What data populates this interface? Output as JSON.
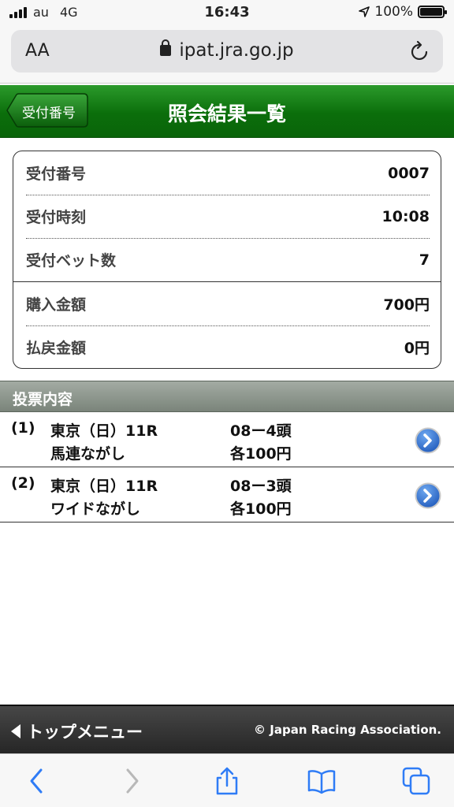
{
  "status_bar": {
    "carrier": "au",
    "network": "4G",
    "time": "16:43",
    "battery": "100%"
  },
  "browser": {
    "text_size": "AA",
    "url": "ipat.jra.go.jp"
  },
  "header": {
    "back_label": "受付番号",
    "title": "照会結果一覧"
  },
  "receipt": [
    {
      "label": "受付番号",
      "value": "0007"
    },
    {
      "label": "受付時刻",
      "value": "10:08"
    },
    {
      "label": "受付ベット数",
      "value": "7"
    },
    {
      "label": "購入金額",
      "value": "700円"
    },
    {
      "label": "払戻金額",
      "value": "0円"
    }
  ],
  "section": {
    "title": "投票内容"
  },
  "bets": [
    {
      "num": "(1)",
      "race": "東京（日）11R",
      "type": "馬連ながし",
      "horses": "08ー4頭",
      "amount": "各100円"
    },
    {
      "num": "(2)",
      "race": "東京（日）11R",
      "type": "ワイドながし",
      "horses": "08ー3頭",
      "amount": "各100円"
    }
  ],
  "footer": {
    "top_menu": "トップメニュー",
    "copyright": "© Japan Racing Association."
  },
  "colors": {
    "header_green": "#0b6e0b",
    "arrow_blue": "#2e6fd0"
  }
}
